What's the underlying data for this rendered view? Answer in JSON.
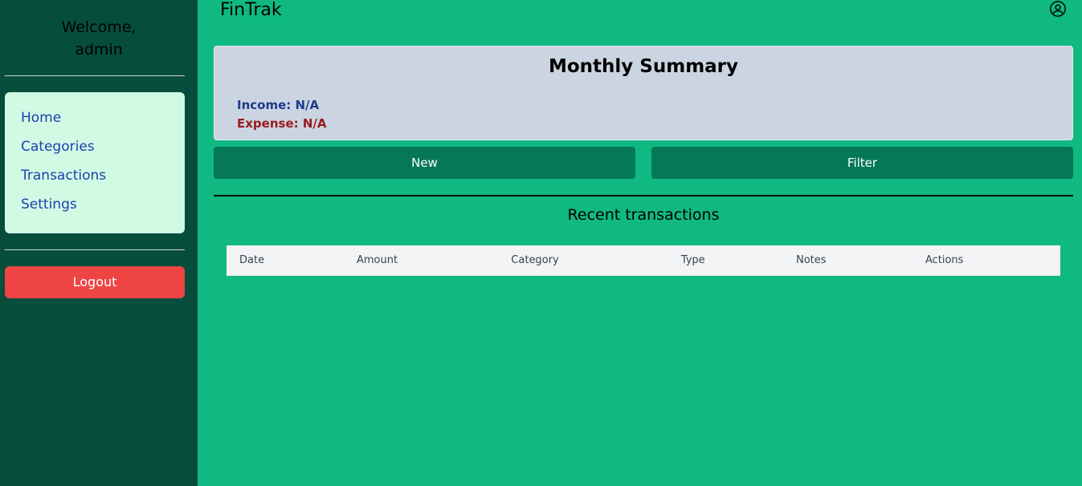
{
  "sidebar": {
    "welcome_line1": "Welcome,",
    "welcome_line2": "admin",
    "nav": [
      {
        "label": "Home"
      },
      {
        "label": "Categories"
      },
      {
        "label": "Transactions"
      },
      {
        "label": "Settings"
      }
    ],
    "logout_label": "Logout"
  },
  "header": {
    "app_title": "FinTrak",
    "user_icon": "user-circle-icon"
  },
  "summary": {
    "title": "Monthly Summary",
    "income": "Income: N/A",
    "expense": "Expense: N/A"
  },
  "actions": {
    "new_label": "New",
    "filter_label": "Filter"
  },
  "transactions": {
    "title": "Recent transactions",
    "columns": [
      "Date",
      "Amount",
      "Category",
      "Type",
      "Notes",
      "Actions"
    ]
  },
  "colors": {
    "main_bg": "#10b981",
    "sidebar_bg": "#064e3b",
    "nav_bg": "#d1fae5",
    "logout_bg": "#ef4444",
    "button_bg": "#047857",
    "summary_bg": "#cbd5e1"
  }
}
